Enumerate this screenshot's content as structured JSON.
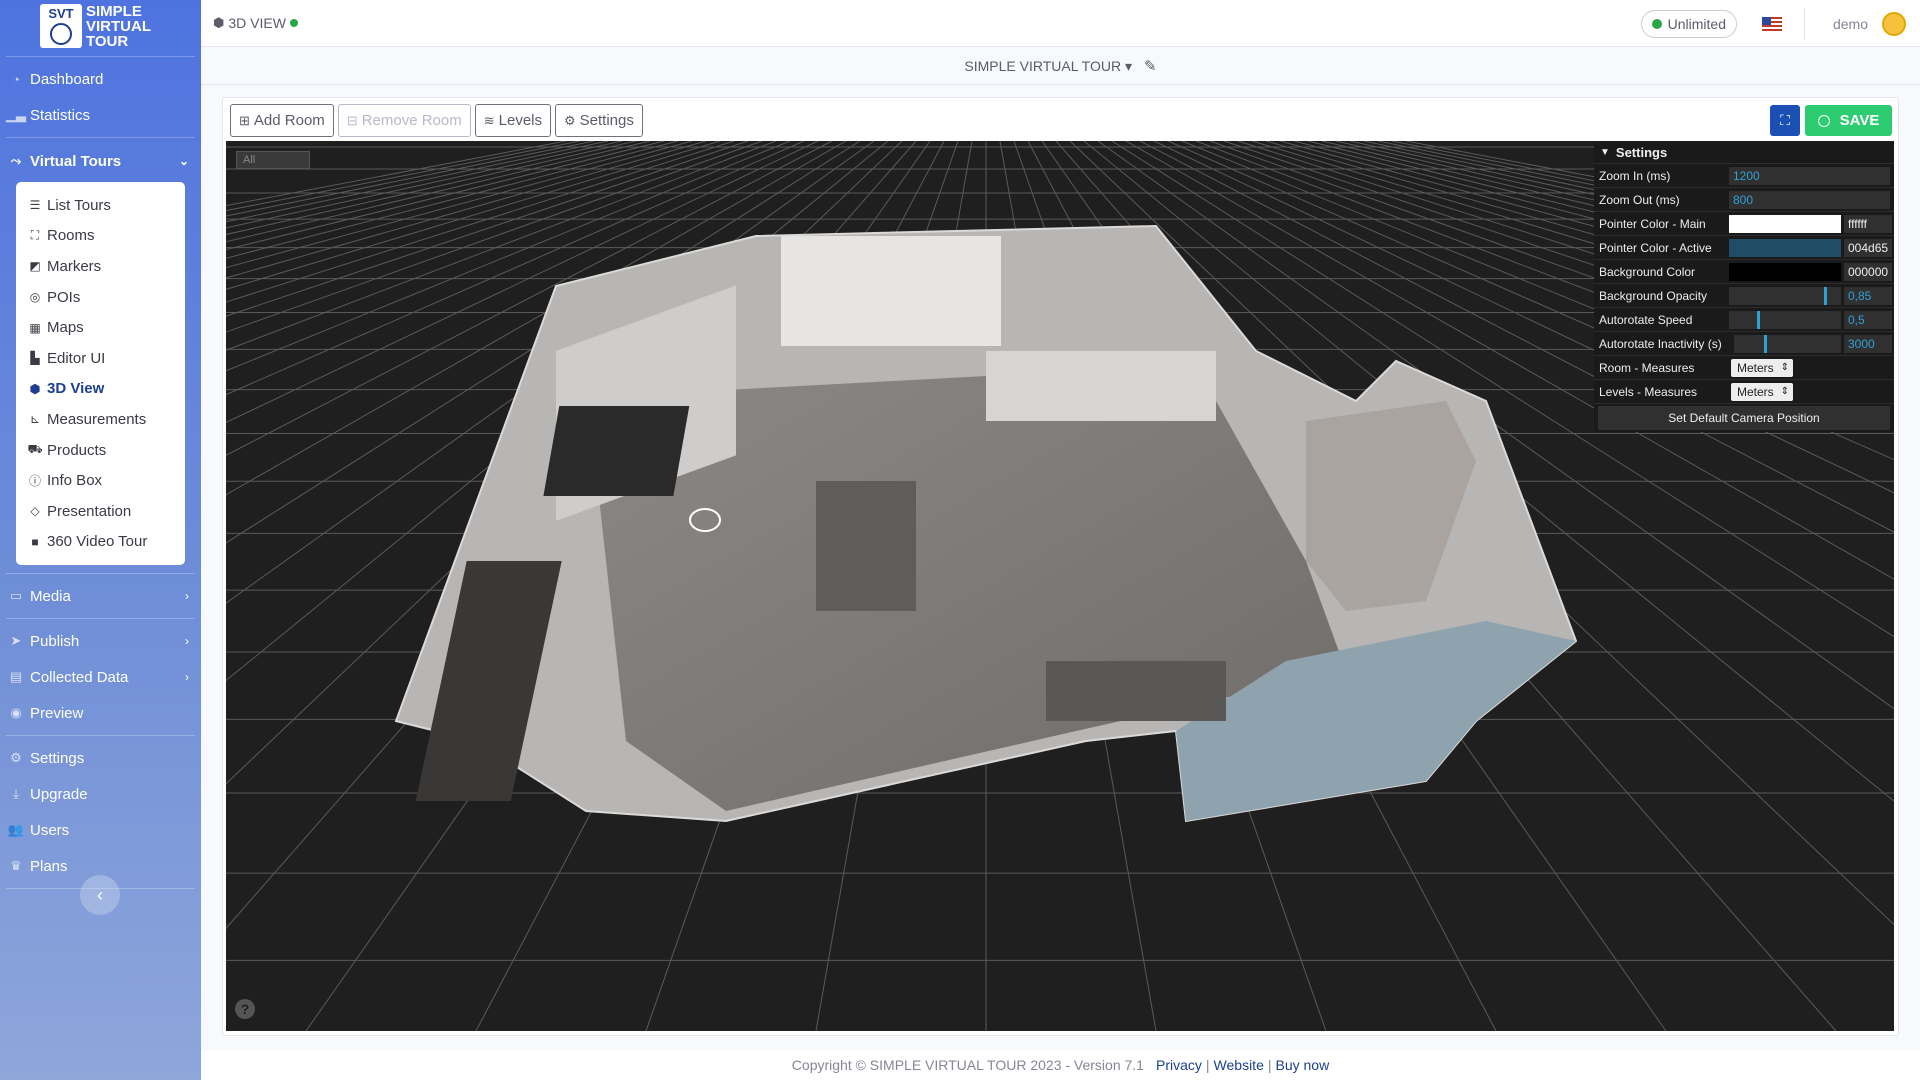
{
  "brand": {
    "badge": "SVT",
    "name_line1": "SIMPLE",
    "name_line2": "VIRTUAL",
    "name_line3": "TOUR"
  },
  "sidebar": {
    "items_top": [
      {
        "label": "Dashboard",
        "icon": "dashboard-icon"
      },
      {
        "label": "Statistics",
        "icon": "chart-icon"
      }
    ],
    "virtual_tours": {
      "label": "Virtual Tours",
      "icon": "route-icon"
    },
    "submenu": [
      {
        "label": "List Tours",
        "icon": "list-icon"
      },
      {
        "label": "Rooms",
        "icon": "vector-square-icon"
      },
      {
        "label": "Markers",
        "icon": "caret-square-icon"
      },
      {
        "label": "POIs",
        "icon": "bullseye-icon"
      },
      {
        "label": "Maps",
        "icon": "map-icon"
      },
      {
        "label": "Editor UI",
        "icon": "swatchbook-icon"
      },
      {
        "label": "3D View",
        "icon": "cube-icon",
        "active": true
      },
      {
        "label": "Measurements",
        "icon": "ruler-icon"
      },
      {
        "label": "Products",
        "icon": "cart-icon"
      },
      {
        "label": "Info Box",
        "icon": "info-circle-icon"
      },
      {
        "label": "Presentation",
        "icon": "diamond-icon"
      },
      {
        "label": "360 Video Tour",
        "icon": "video-icon"
      }
    ],
    "items_mid": [
      {
        "label": "Media",
        "icon": "desktop-icon",
        "chevron": true
      },
      {
        "label": "Publish",
        "icon": "paper-plane-icon",
        "chevron": true
      },
      {
        "label": "Collected Data",
        "icon": "database-icon",
        "chevron": true
      },
      {
        "label": "Preview",
        "icon": "eye-icon"
      }
    ],
    "items_bottom": [
      {
        "label": "Settings",
        "icon": "cogs-icon"
      },
      {
        "label": "Upgrade",
        "icon": "download-icon"
      },
      {
        "label": "Users",
        "icon": "users-icon"
      },
      {
        "label": "Plans",
        "icon": "crown-icon"
      }
    ]
  },
  "topbar": {
    "page_label": "3D VIEW",
    "plan_badge": "Unlimited",
    "user_name": "demo"
  },
  "tourbar": {
    "tour_name": "SIMPLE VIRTUAL TOUR"
  },
  "toolbar": {
    "add_room": "Add Room",
    "remove_room": "Remove Room",
    "levels": "Levels",
    "settings": "Settings",
    "save": "SAVE"
  },
  "viewport": {
    "level_select": "All"
  },
  "settings_panel": {
    "title": "Settings",
    "zoom_in_label": "Zoom In (ms)",
    "zoom_in_value": "1200",
    "zoom_out_label": "Zoom Out (ms)",
    "zoom_out_value": "800",
    "pointer_main_label": "Pointer Color - Main",
    "pointer_main_value": "ffffff",
    "pointer_main_color": "#ffffff",
    "pointer_active_label": "Pointer Color - Active",
    "pointer_active_value": "004d65",
    "pointer_active_color": "#1e4d65",
    "bg_color_label": "Background Color",
    "bg_color_value": "000000",
    "bg_color_color": "#000000",
    "bg_opacity_label": "Background Opacity",
    "bg_opacity_value": "0,85",
    "autorotate_speed_label": "Autorotate Speed",
    "autorotate_speed_value": "0,5",
    "autorotate_inactivity_label": "Autorotate Inactivity (s)",
    "autorotate_inactivity_value": "3000",
    "room_measures_label": "Room - Measures",
    "room_measures_value": "Meters",
    "levels_measures_label": "Levels - Measures",
    "levels_measures_value": "Meters",
    "default_camera_button": "Set Default Camera Position"
  },
  "footer": {
    "copyright": "Copyright © SIMPLE VIRTUAL TOUR 2023 - Version 7.1",
    "privacy": "Privacy",
    "website": "Website",
    "buy_now": "Buy now",
    "separator": "|"
  },
  "colors": {
    "sidebar_top": "#4e73df",
    "accent_blue": "#1c4fb4",
    "save_green": "#2ecc71",
    "status_green": "#27a844"
  }
}
